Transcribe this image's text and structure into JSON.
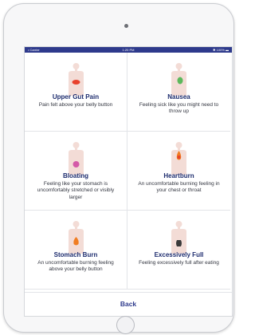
{
  "status_bar": {
    "carrier": "Carrier",
    "time": "1:20 PM",
    "battery": "100%"
  },
  "symptoms": [
    {
      "title": "Upper Gut Pain",
      "description": "Pain felt above your belly button",
      "highlight_color": "#e8412c"
    },
    {
      "title": "Nausea",
      "description": "Feeling sick like you might need to throw up",
      "highlight_color": "#5cb85c"
    },
    {
      "title": "Bloating",
      "description": "Feeling like your stomach is uncomfortably stretched or visibly larger",
      "highlight_color": "#d45aa8"
    },
    {
      "title": "Heartburn",
      "description": "An uncomfortable burning feeling in your chest or throat",
      "highlight_color": "#f07d22"
    },
    {
      "title": "Stomach Burn",
      "description": "An uncomfortable burning feeling above your belly button",
      "highlight_color": "#f07d22"
    },
    {
      "title": "Excessively Full",
      "description": "Feeling excessively full after eating",
      "highlight_color": "#3b3b3b"
    }
  ],
  "footer": {
    "back_label": "Back"
  },
  "colors": {
    "accent": "#2e3a8c",
    "title": "#1d2c6e",
    "body_silhouette": "#f3dcd6"
  }
}
